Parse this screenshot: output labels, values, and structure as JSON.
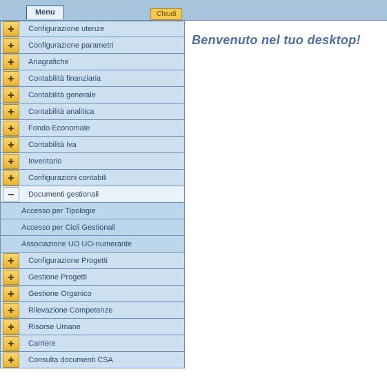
{
  "header": {
    "menu_label": "Menu",
    "chiudi_label": "Chiudi"
  },
  "welcome_text": "Benvenuto nel tuo desktop!",
  "sidebar": {
    "items": [
      {
        "label": "Configurazione utenze",
        "expanded": false,
        "children": []
      },
      {
        "label": "Configurazione parametri",
        "expanded": false,
        "children": []
      },
      {
        "label": "Anagrafiche",
        "expanded": false,
        "children": []
      },
      {
        "label": "Contabilità finanziaria",
        "expanded": false,
        "children": []
      },
      {
        "label": "Contabilità generale",
        "expanded": false,
        "children": []
      },
      {
        "label": "Contabilità analitica",
        "expanded": false,
        "children": []
      },
      {
        "label": "Fondo Economale",
        "expanded": false,
        "children": []
      },
      {
        "label": "Contabilità Iva",
        "expanded": false,
        "children": []
      },
      {
        "label": "Inventario",
        "expanded": false,
        "children": []
      },
      {
        "label": "Configurazioni contabili",
        "expanded": false,
        "children": []
      },
      {
        "label": "Documenti gestionali",
        "expanded": true,
        "children": [
          "Accesso per Tipologie",
          "Accesso per Cicli Gestionali",
          "Associazione UO UO-numerante"
        ]
      },
      {
        "label": "Configurazione Progetti",
        "expanded": false,
        "children": []
      },
      {
        "label": "Gestione Progetti",
        "expanded": false,
        "children": []
      },
      {
        "label": "Gestione Organico",
        "expanded": false,
        "children": []
      },
      {
        "label": "Rilevazione Competenze",
        "expanded": false,
        "children": []
      },
      {
        "label": "Risorse Umane",
        "expanded": false,
        "children": []
      },
      {
        "label": "Carriere",
        "expanded": false,
        "children": []
      },
      {
        "label": "Consulta documenti CSA",
        "expanded": false,
        "children": []
      }
    ]
  }
}
